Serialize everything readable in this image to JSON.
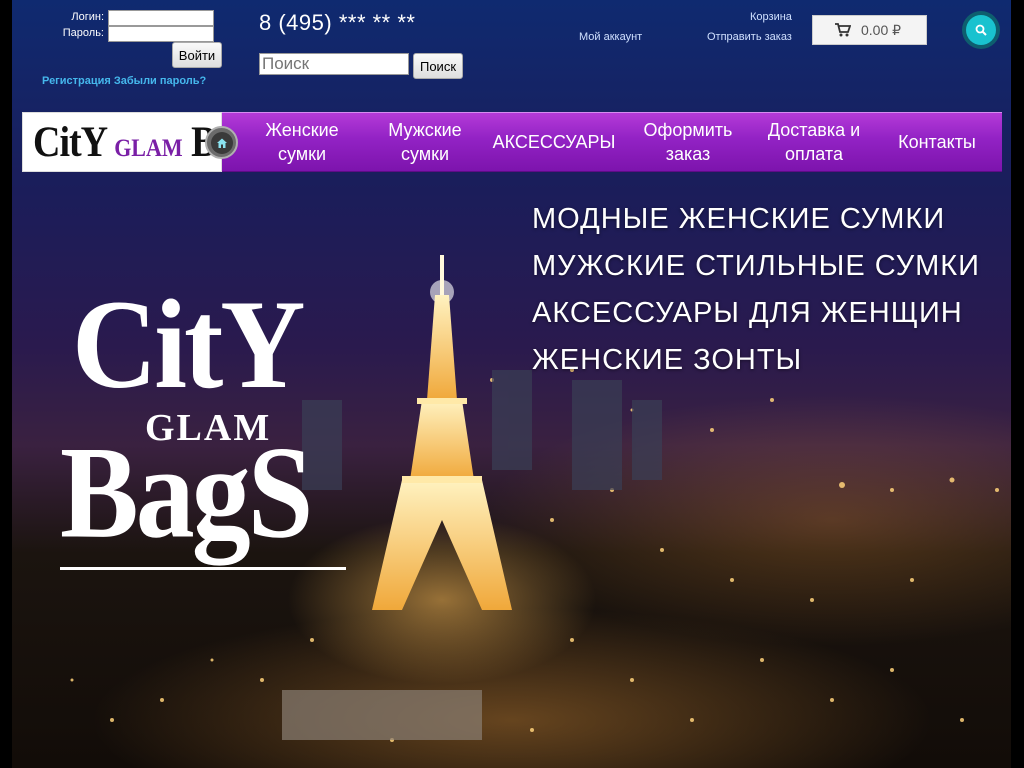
{
  "login": {
    "login_label": "Логин:",
    "password_label": "Пароль:",
    "submit_label": "Войти",
    "register_link": "Регистрация",
    "forgot_link": "Забыли пароль?"
  },
  "header": {
    "phone": "8 (495) *** ** **",
    "search_placeholder": "Поиск",
    "search_button": "Поиск",
    "cart_link": "Корзина",
    "account_link": "Мой аккаунт",
    "send_order_link": "Отправить заказ",
    "cart_total": "0.00 ₽"
  },
  "logo": {
    "part1": "CitY",
    "part2": "GLAM",
    "part3": "BagS"
  },
  "nav": {
    "items": [
      {
        "label": "Женские сумки"
      },
      {
        "label": "Мужские сумки"
      },
      {
        "label": "АКСЕССУАРЫ"
      },
      {
        "label": "Оформить заказ"
      },
      {
        "label": "Доставка и оплата"
      },
      {
        "label": "Контакты"
      }
    ]
  },
  "hero": {
    "big_logo": {
      "city": "CitY",
      "glam": "GLAM",
      "bags": "BagS"
    },
    "promo": [
      {
        "label": "МОДНЫЕ ЖЕНСКИЕ СУМКИ"
      },
      {
        "label": "МУЖСКИЕ СТИЛЬНЫЕ СУМКИ"
      },
      {
        "label": "АКСЕССУАРЫ ДЛЯ ЖЕНЩИН"
      },
      {
        "label": "ЖЕНСКИЕ ЗОНТЫ"
      }
    ]
  },
  "colors": {
    "nav_purple": "#9222c4",
    "link_blue": "#45b7ec",
    "search_teal": "#19c2cf"
  },
  "icons": {
    "cart": "cart-icon",
    "search": "search-icon",
    "home": "home-icon"
  }
}
